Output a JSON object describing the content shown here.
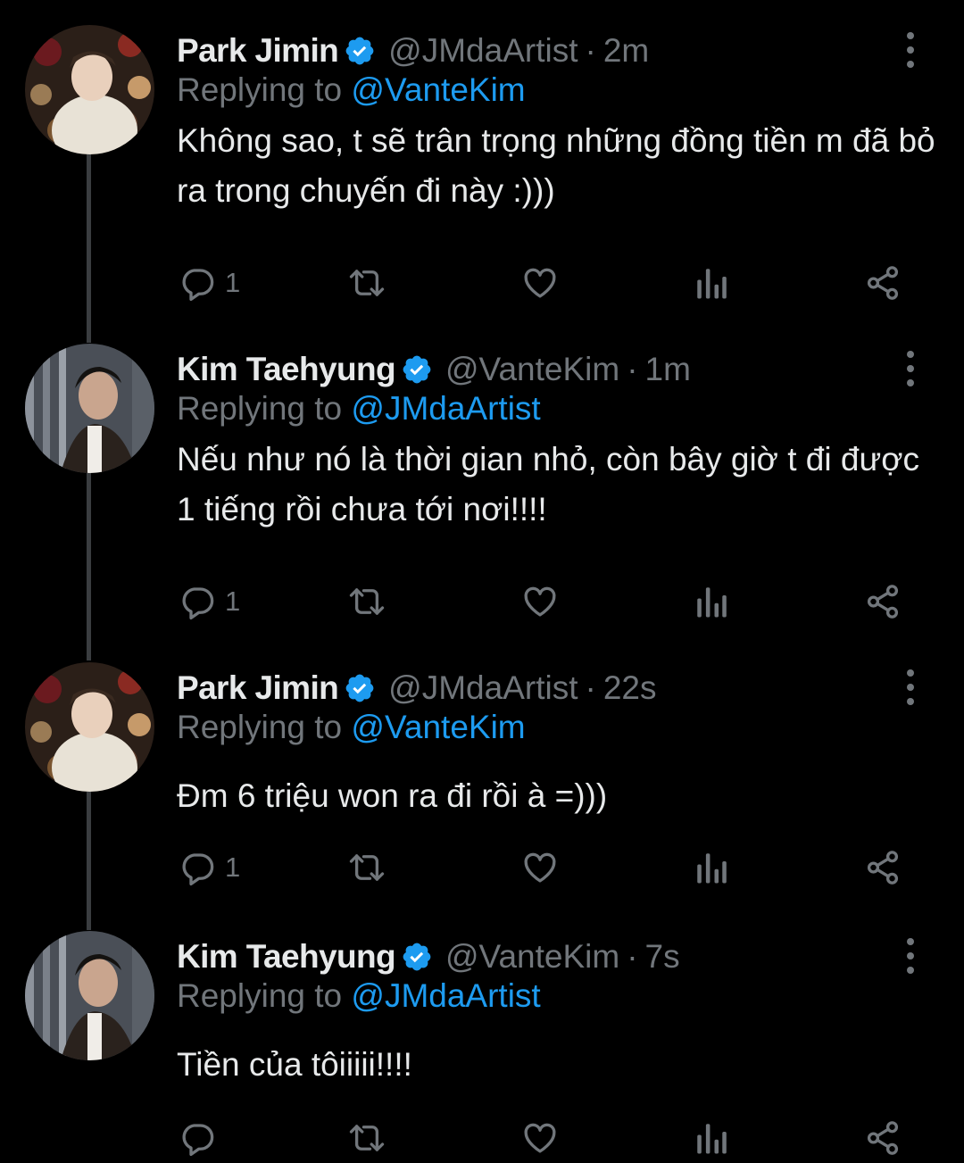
{
  "colors": {
    "background": "#000000",
    "primary_text": "#e7e9ea",
    "secondary_text": "#71767b",
    "link": "#1d9bf0",
    "verified": "#1d9bf0",
    "thread_line": "#3a3d40"
  },
  "icons": [
    "verified-badge-icon",
    "more-options-icon",
    "reply-icon",
    "retweet-icon",
    "like-icon",
    "analytics-icon",
    "share-icon"
  ],
  "replying_prefix": "Replying to",
  "time_separator": "·",
  "tweets": [
    {
      "name": "Park Jimin",
      "handle": "@JMdaArtist",
      "time": "2m",
      "replying_to": "@VanteKim",
      "text": "Không sao, t sẽ trân trọng những đồng tiền m đã bỏ ra trong chuyến đi này :)))",
      "reply_count": "1"
    },
    {
      "name": "Kim Taehyung",
      "handle": "@VanteKim",
      "time": "1m",
      "replying_to": "@JMdaArtist",
      "text": "Nếu như nó là thời gian nhỏ, còn bây giờ t đi được 1 tiếng rồi chưa tới nơi!!!!",
      "reply_count": "1"
    },
    {
      "name": "Park Jimin",
      "handle": "@JMdaArtist",
      "time": "22s",
      "replying_to": "@VanteKim",
      "text": "Đm 6 triệu won ra đi rồi à =)))",
      "reply_count": "1"
    },
    {
      "name": "Kim Taehyung",
      "handle": "@VanteKim",
      "time": "7s",
      "replying_to": "@JMdaArtist",
      "text": "Tiền của tôiiiii!!!!",
      "reply_count": ""
    }
  ]
}
